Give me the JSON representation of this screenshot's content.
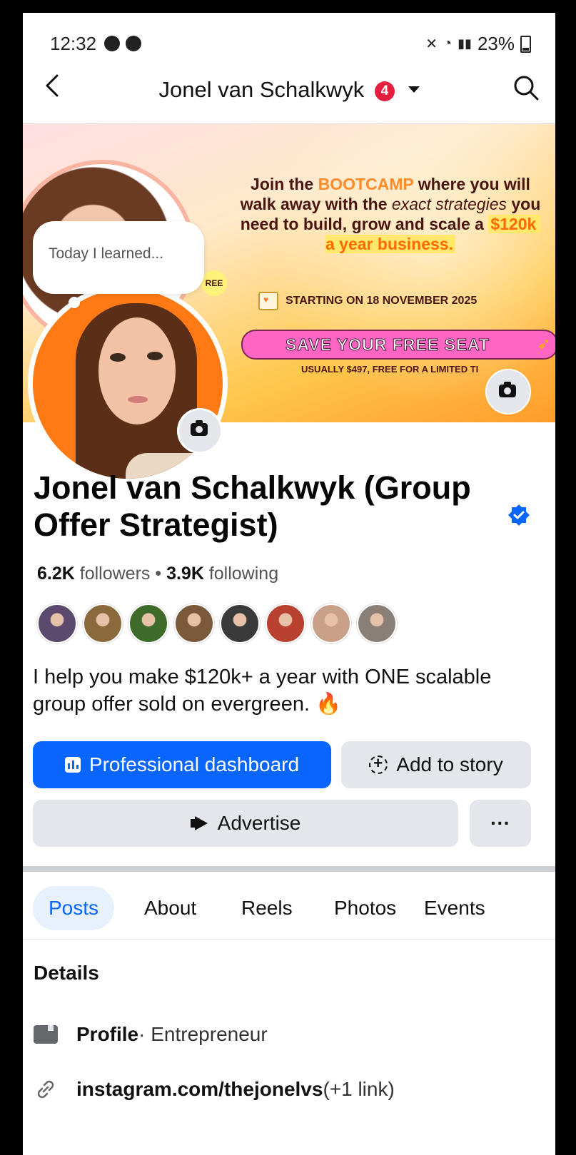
{
  "status_bar": {
    "time": "12:32",
    "battery": "23%"
  },
  "nav": {
    "title": "Jonel van Schalkwyk",
    "badge": "4"
  },
  "cover": {
    "headline": {
      "part1": "Join the ",
      "bootcamp": "BOOTCAMP",
      "part2": " where you will walk away with the ",
      "italic": "exact strategies",
      "part3": " you need to build, grow and scale a ",
      "amount": "$120k",
      "part4": " a year business."
    },
    "starting": "STARTING ON 18 NOVEMBER 2025",
    "cta": "SAVE YOUR FREE SEAT",
    "subtext": "USUALLY $497, FREE FOR A LIMITED TI",
    "ribbon_fragment": "REE"
  },
  "note": {
    "text": "Today I learned..."
  },
  "profile": {
    "name": "Jonel van Schalkwyk (Group Offer Strategist)",
    "followers_count": "6.2K",
    "followers_label": " followers",
    "following_count": "3.9K",
    "following_label": " following",
    "separator": " • ",
    "bio": "I help you make $120k+ a year with ONE scalable group offer sold on evergreen. 🔥",
    "friend_colors": [
      "#5b4a6e",
      "#8a6a3c",
      "#3f6b2a",
      "#7a5a3a",
      "#3a3a3a",
      "#b9412f",
      "#c9a18a",
      "#8a7f76"
    ]
  },
  "buttons": {
    "dashboard": "Professional dashboard",
    "story": "Add to story",
    "advertise": "Advertise",
    "more": "···"
  },
  "tabs": [
    "Posts",
    "About",
    "Reels",
    "Photos",
    "Events"
  ],
  "details": {
    "title": "Details",
    "profile_label": "Profile",
    "profile_value": " · Entrepreneur",
    "link_label": "instagram.com/thejonelvs",
    "link_extra": " (+1 link)"
  },
  "colors": {
    "accent": "#0866ff",
    "badge": "#e41e3f"
  }
}
